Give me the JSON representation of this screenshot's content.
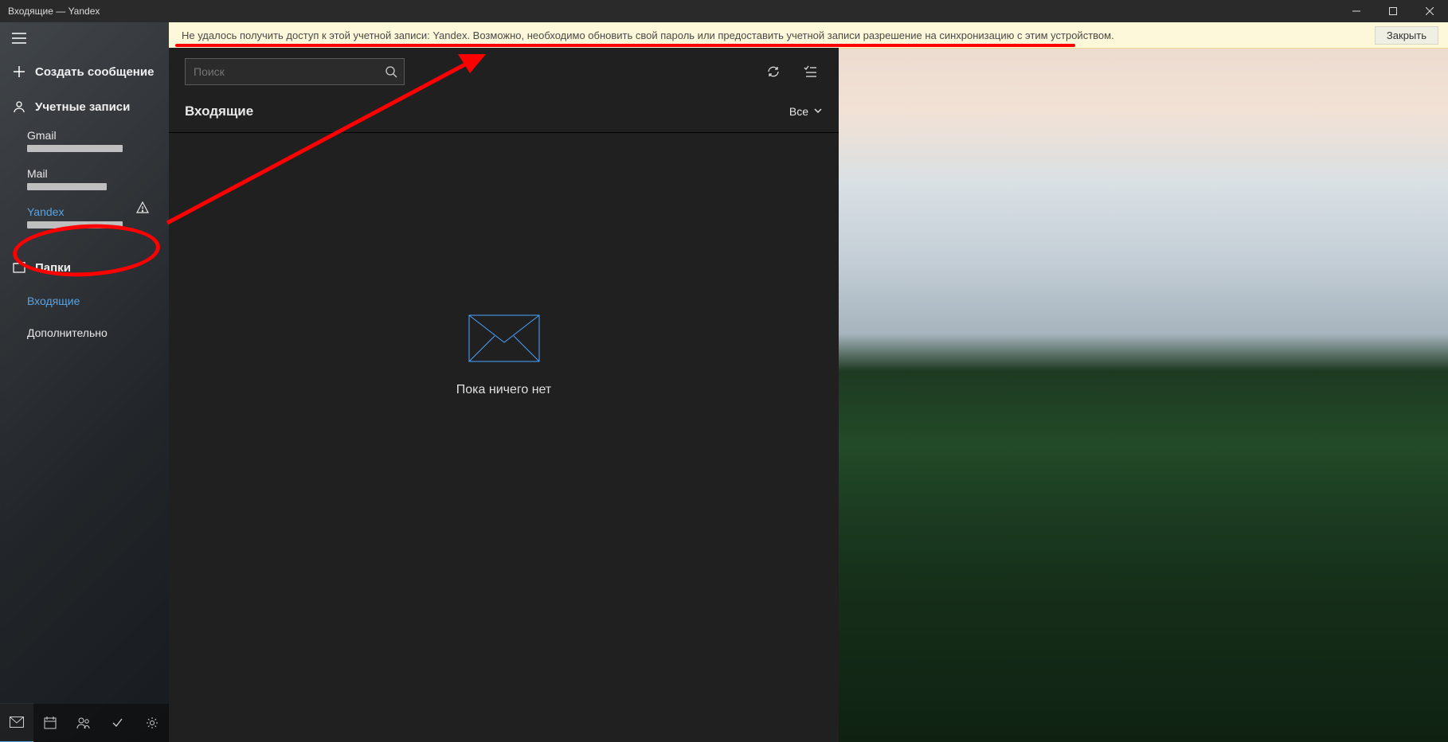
{
  "window": {
    "title": "Входящие — Yandex"
  },
  "notice": {
    "message": "Не удалось получить доступ к этой учетной записи: Yandex. Возможно, необходимо обновить свой пароль или предоставить учетной записи разрешение на синхронизацию с этим устройством.",
    "close_btn": "Закрыть"
  },
  "sidebar": {
    "compose": "Создать сообщение",
    "accounts_header": "Учетные записи",
    "accounts": [
      {
        "name": "Gmail",
        "active": false
      },
      {
        "name": "Mail",
        "active": false
      },
      {
        "name": "Yandex",
        "active": true
      }
    ],
    "folders_header": "Папки",
    "folders": [
      {
        "label": "Входящие",
        "active": true
      },
      {
        "label": "Дополнительно",
        "active": false
      }
    ]
  },
  "main": {
    "search_placeholder": "Поиск",
    "inbox_title": "Входящие",
    "filter_label": "Все",
    "empty_text": "Пока ничего нет"
  }
}
